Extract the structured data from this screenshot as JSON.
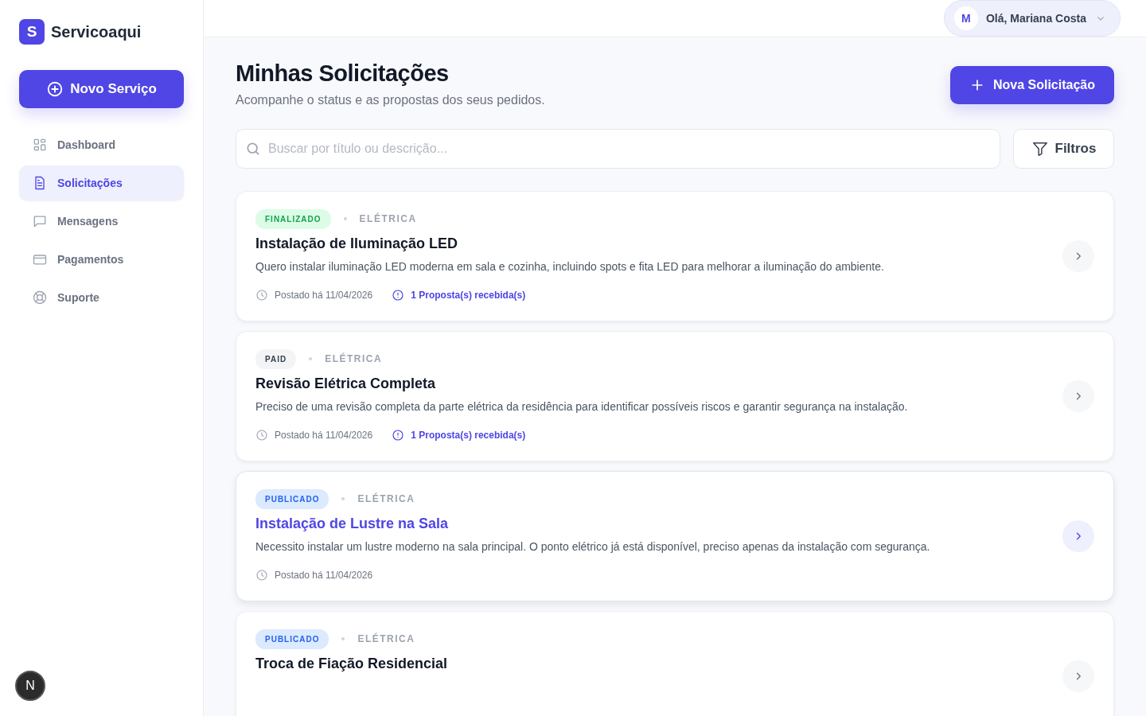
{
  "brand": {
    "logo_letter": "S",
    "name": "Servicoaqui"
  },
  "new_service_button": "Novo Serviço",
  "nav": [
    {
      "label": "Dashboard",
      "kind": "grid",
      "selected": false
    },
    {
      "label": "Solicitações",
      "kind": "document",
      "selected": true
    },
    {
      "label": "Mensagens",
      "kind": "chat",
      "selected": false
    },
    {
      "label": "Pagamentos",
      "kind": "card",
      "selected": false
    },
    {
      "label": "Suporte",
      "kind": "lifebuoy",
      "selected": false
    }
  ],
  "dev_badge": "N",
  "user_menu": {
    "avatar_letter": "M",
    "greeting": "Olá, Mariana Costa"
  },
  "page": {
    "title": "Minhas Solicitações",
    "subtitle": "Acompanhe o status e as propostas dos seus pedidos.",
    "new_button": "Nova Solicitação"
  },
  "search": {
    "placeholder": "Buscar por título ou descrição..."
  },
  "filter_button": "Filtros",
  "requests": [
    {
      "status": "FINALIZADO",
      "kind": "done",
      "category": "ELÉTRICA",
      "title": "Instalação de Iluminação LED",
      "description": "Quero instalar iluminação LED moderna em sala e cozinha, incluindo spots e fita LED para melhorar a iluminação do ambiente.",
      "posted": "Postado há 11/04/2026",
      "proposals": "1 Proposta(s) recebida(s)",
      "highlighted": false
    },
    {
      "status": "PAID",
      "kind": "paid",
      "category": "ELÉTRICA",
      "title": "Revisão Elétrica Completa",
      "description": "Preciso de uma revisão completa da parte elétrica da residência para identificar possíveis riscos e garantir segurança na instalação.",
      "posted": "Postado há 11/04/2026",
      "proposals": "1 Proposta(s) recebida(s)",
      "highlighted": false
    },
    {
      "status": "PUBLICADO",
      "kind": "published",
      "category": "ELÉTRICA",
      "title": "Instalação de Lustre na Sala",
      "description": "Necessito instalar um lustre moderno na sala principal. O ponto elétrico já está disponível, preciso apenas da instalação com segurança.",
      "posted": "Postado há 11/04/2026",
      "highlighted": true
    },
    {
      "status": "PUBLICADO",
      "kind": "published",
      "category": "ELÉTRICA",
      "title": "Troca de Fiação Residencial",
      "highlighted": false
    }
  ]
}
